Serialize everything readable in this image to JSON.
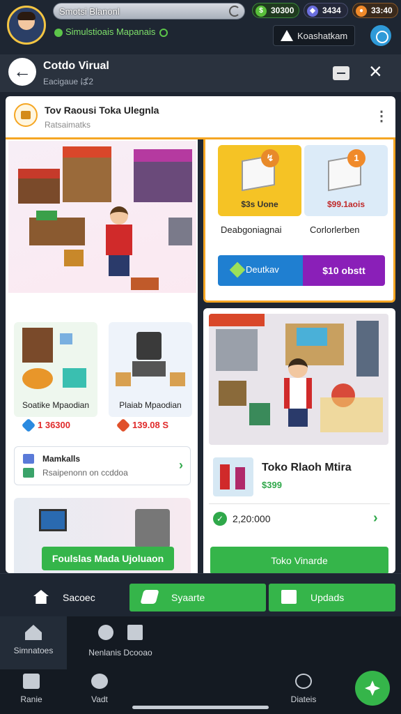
{
  "topbar": {
    "player_name": "Smotsi Blanonl",
    "subtitle": "Simulstioais Mapanais",
    "currencies": [
      {
        "icon": "cash-icon",
        "value": "30300"
      },
      {
        "icon": "gem-icon",
        "value": "3434"
      },
      {
        "icon": "fire-icon",
        "value": "33:40"
      }
    ],
    "alert_label": "Koashatkam"
  },
  "header": {
    "title": "Cotdo Virual",
    "subtitle": "Eacigaue ぱ2"
  },
  "shop": {
    "title": "Tov Raousi Toka Ulegnla",
    "subtitle": "Ratsaimatks"
  },
  "left": {
    "items": [
      {
        "name": "Soatike Mpaodian",
        "price": "1 36300",
        "price_icon": "diamond-icon",
        "price_color": "#2a8ae0"
      },
      {
        "name": "Plaiab Mpaodian",
        "price": "139.08 S",
        "price_icon": "ruby-icon",
        "price_color": "#e0502a"
      }
    ],
    "materials": {
      "title": "Mamkalls",
      "subtitle": "Rsaipenonn on ccddoa"
    },
    "banner": "Foulslas Mada Ujoluaon"
  },
  "right": {
    "offers": [
      {
        "price": "$3s Uone",
        "label": "Deabgoniagnai",
        "badge": "↯"
      },
      {
        "price": "$99.1aois",
        "label": "Corlorlerben",
        "badge": "1"
      }
    ],
    "buy_left": "Deutkav",
    "buy_right": "$10 obstt",
    "card": {
      "title": "Toko Rlaoh Mtira",
      "price": "$399",
      "stat": "2,20:000",
      "cta": "Toko Vinarde"
    }
  },
  "actions": {
    "home": "Sacoec",
    "spend": "Syaarte",
    "upgrade": "Updads"
  },
  "tabs": {
    "tab1": "Simnatoes",
    "tab2": "Nenlanis Dcooao",
    "tab3": "Ranie",
    "tab4": "Vadt",
    "tab5": "Diateis"
  }
}
